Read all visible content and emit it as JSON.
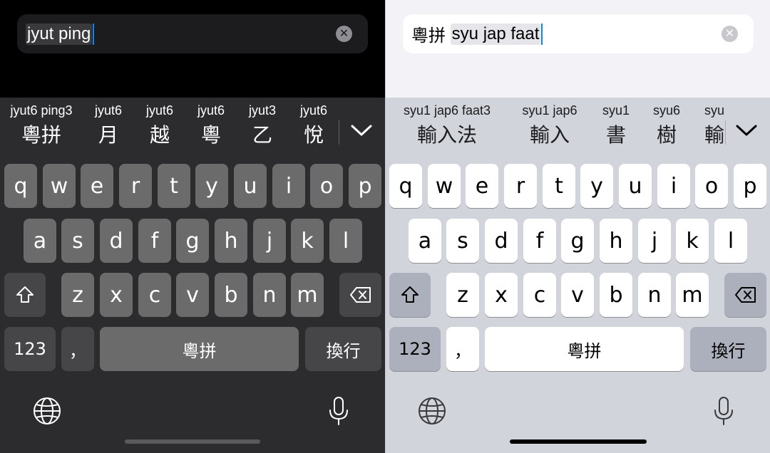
{
  "left": {
    "search": {
      "text": "jyut ping"
    },
    "candidates": [
      {
        "rom": "jyut6 ping3",
        "han": "粵拼"
      },
      {
        "rom": "jyut6",
        "han": "月"
      },
      {
        "rom": "jyut6",
        "han": "越"
      },
      {
        "rom": "jyut6",
        "han": "粵"
      },
      {
        "rom": "jyut3",
        "han": "乙"
      },
      {
        "rom": "jyut6",
        "han": "悅"
      }
    ],
    "space_label": "粵拼",
    "return_label": "換行",
    "numbers_label": "123",
    "comma_label": "，"
  },
  "right": {
    "search": {
      "prefix": "粵拼 ",
      "text": "syu jap faat"
    },
    "candidates": [
      {
        "rom": "syu1 jap6 faat3",
        "han": "輸入法"
      },
      {
        "rom": "syu1 jap6",
        "han": "輸入"
      },
      {
        "rom": "syu1",
        "han": "書"
      },
      {
        "rom": "syu6",
        "han": "樹"
      },
      {
        "rom": "syu",
        "han": "輸"
      }
    ],
    "space_label": "粵拼",
    "return_label": "換行",
    "numbers_label": "123",
    "comma_label": "，"
  },
  "keys": {
    "row1": [
      "q",
      "w",
      "e",
      "r",
      "t",
      "y",
      "u",
      "i",
      "o",
      "p"
    ],
    "row2": [
      "a",
      "s",
      "d",
      "f",
      "g",
      "h",
      "j",
      "k",
      "l"
    ],
    "row3": [
      "z",
      "x",
      "c",
      "v",
      "b",
      "n",
      "m"
    ]
  },
  "icons": {
    "clear": "clear-icon",
    "collapse": "chevron-down-icon",
    "shift": "shift-icon",
    "backspace": "backspace-icon",
    "globe": "globe-icon",
    "mic": "microphone-icon"
  }
}
